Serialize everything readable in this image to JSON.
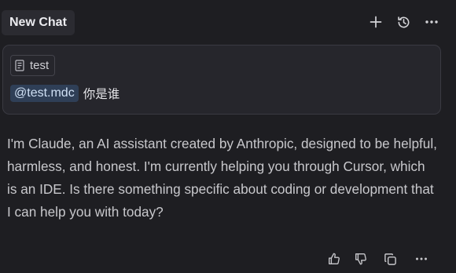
{
  "header": {
    "tab_label": "New Chat",
    "icons": [
      "plus-icon",
      "history-icon",
      "more-icon"
    ]
  },
  "user_message": {
    "file_chip": {
      "icon": "file-icon",
      "label": "test"
    },
    "mention": "@test.mdc",
    "text": "你是谁"
  },
  "assistant_message": {
    "text": "I'm Claude, an AI assistant created by Anthropic, designed to be helpful, harmless, and honest. I'm currently helping you through Cursor, which is an IDE. Is there something specific about coding or development that I can help you with today?"
  },
  "message_actions": {
    "icons": [
      "thumbs-up-icon",
      "thumbs-down-icon",
      "copy-icon",
      "more-icon"
    ]
  },
  "colors": {
    "background": "#1e1e22",
    "card": "#26262c",
    "mention_bg": "#2f3f57"
  }
}
